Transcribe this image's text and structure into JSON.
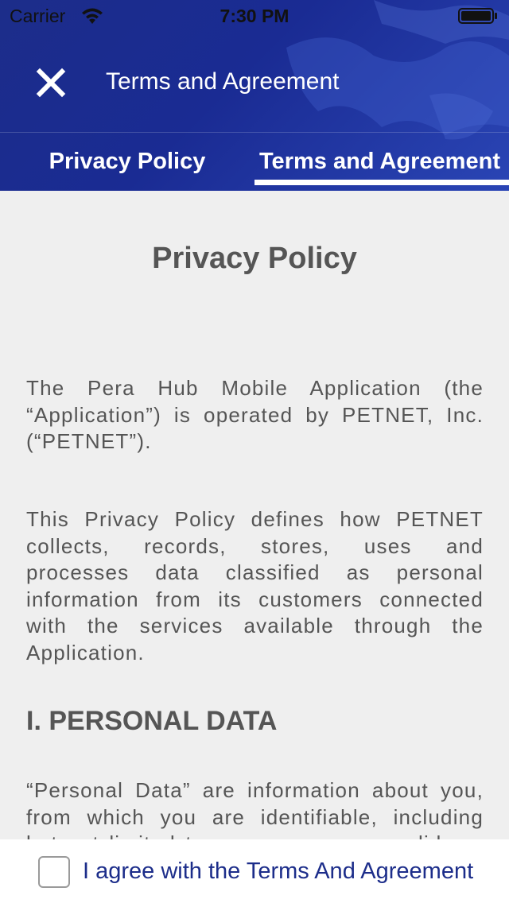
{
  "status_bar": {
    "carrier": "Carrier",
    "time": "7:30 PM",
    "wifi_icon": "wifi-icon",
    "battery_icon": "battery-icon"
  },
  "nav": {
    "title": "Terms and Agreement",
    "close_icon": "close-icon"
  },
  "tabs": [
    {
      "label": "Privacy Policy",
      "selected": false
    },
    {
      "label": "Terms and Agreement",
      "selected": true
    }
  ],
  "document": {
    "title": "Privacy Policy",
    "paragraphs": [
      "The Pera Hub Mobile Application (the “Application”) is operated by PETNET, Inc. (“PETNET”).",
      "This Privacy Policy defines how PETNET collects, records, stores, uses and processes data classified as personal information from its customers connected with the services available through the Application."
    ],
    "section_heading": "I. PERSONAL DATA",
    "section_paragraph": "“Personal Data” are information about you, from which you are identifiable, including but not limited to your name, age, valid"
  },
  "footer": {
    "agree_label": "I agree with the Terms And Agreement",
    "agree_checked": false
  },
  "colors": {
    "header": "#1c2d8a",
    "accent": "#1c2d8a",
    "background": "#efefef",
    "text": "#555555"
  }
}
